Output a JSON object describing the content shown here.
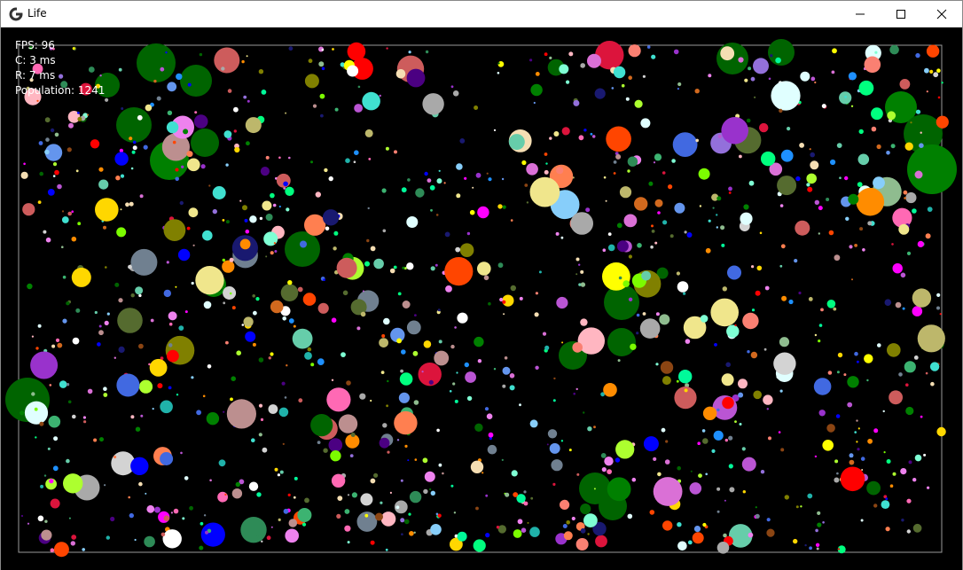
{
  "window": {
    "title": "Life"
  },
  "stats": {
    "fps": "FPS: 96",
    "c": "C: 3 ms",
    "r": "R: 7 ms",
    "population": "Population: 1241"
  },
  "colors": {
    "palette": [
      "#006400",
      "#008000",
      "#1e90ff",
      "#0000ff",
      "#ff00ff",
      "#ee82ee",
      "#ba55d3",
      "#9370db",
      "#00ff7f",
      "#00fa9a",
      "#3cb371",
      "#7cfc00",
      "#adff2f",
      "#ffff00",
      "#ffd700",
      "#ff8c00",
      "#ff4500",
      "#ff0000",
      "#dc143c",
      "#ff69b4",
      "#ffb6c1",
      "#f5deb3",
      "#d2691e",
      "#8b4513",
      "#808000",
      "#556b2f",
      "#2e8b57",
      "#20b2aa",
      "#40e0d0",
      "#7fffd4",
      "#87cefa",
      "#6495ed",
      "#4169e1",
      "#e0ffff",
      "#ffffff",
      "#d3d3d3",
      "#a9a9a9",
      "#708090",
      "#bc8f8f",
      "#cd5c5c",
      "#da70d6",
      "#9932cc",
      "#4b0082",
      "#191970",
      "#8fbc8f",
      "#66cdaa",
      "#f0e68c",
      "#bdb76b",
      "#ff7f50",
      "#fa8072"
    ],
    "boundary": "#9a9a9a"
  }
}
